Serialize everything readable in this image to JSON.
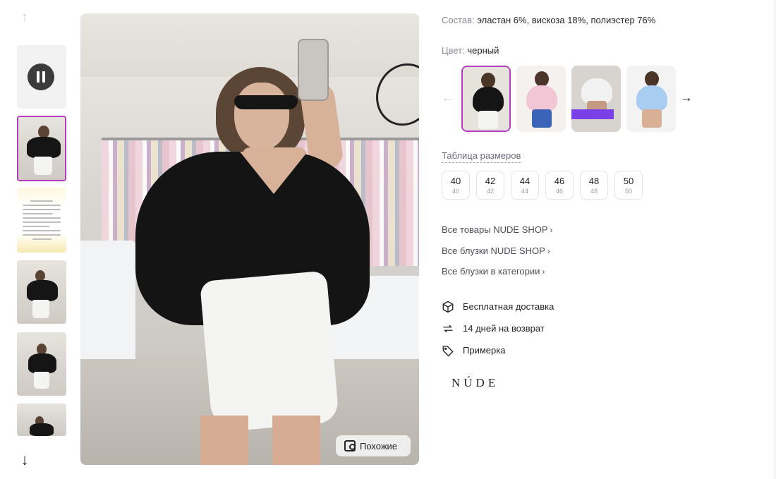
{
  "gallery": {
    "similar_label": "Похожие",
    "thumbnails": [
      "video",
      "photo-1",
      "info-card",
      "photo-3",
      "photo-4",
      "photo-5"
    ]
  },
  "product": {
    "composition_label": "Состав:",
    "composition_value": "эластан 6%, вискоза 18%, полиэстер 76%",
    "color_label": "Цвет:",
    "color_value": "черный",
    "size_table_label": "Таблица размеров",
    "sizes": [
      {
        "size": "40",
        "ru": "40"
      },
      {
        "size": "42",
        "ru": "42"
      },
      {
        "size": "44",
        "ru": "44"
      },
      {
        "size": "46",
        "ru": "46"
      },
      {
        "size": "48",
        "ru": "48"
      },
      {
        "size": "50",
        "ru": "50"
      }
    ]
  },
  "links": {
    "all_brand": "Все товары NUDE SHOP",
    "all_brand_blouses": "Все блузки NUDE SHOP",
    "all_category_blouses": "Все блузки в категории"
  },
  "features": {
    "delivery": "Бесплатная доставка",
    "returns": "14 дней на возврат",
    "fitting": "Примерка"
  },
  "brand": {
    "logo_text": "NÚDE"
  },
  "colors": {
    "accent": "#b53cc0",
    "text": "#242424",
    "muted": "#868695"
  }
}
